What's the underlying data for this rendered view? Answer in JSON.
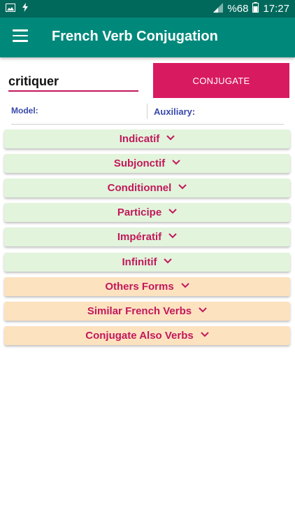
{
  "status_bar": {
    "battery_text": "%68",
    "time": "17:27"
  },
  "app_bar": {
    "title": "French Verb Conjugation"
  },
  "form": {
    "verb_value": "critiquer",
    "conjugate_label": "CONJUGATE",
    "model_label": "Model:",
    "auxiliary_label": "Auxiliary:"
  },
  "sections": [
    {
      "label": "Indicatif",
      "style": "green"
    },
    {
      "label": "Subjonctif",
      "style": "green"
    },
    {
      "label": "Conditionnel",
      "style": "green"
    },
    {
      "label": "Participe",
      "style": "green"
    },
    {
      "label": "Impératif",
      "style": "green"
    },
    {
      "label": "Infinitif",
      "style": "green"
    },
    {
      "label": "Others Forms",
      "style": "orange"
    },
    {
      "label": "Similar French Verbs",
      "style": "orange"
    },
    {
      "label": "Conjugate Also Verbs",
      "style": "orange"
    }
  ],
  "colors": {
    "status_bar": "#00695c",
    "app_bar": "#00897b",
    "accent": "#d81b60",
    "section_green": "#e2f4dc",
    "section_orange": "#fde2c0"
  }
}
